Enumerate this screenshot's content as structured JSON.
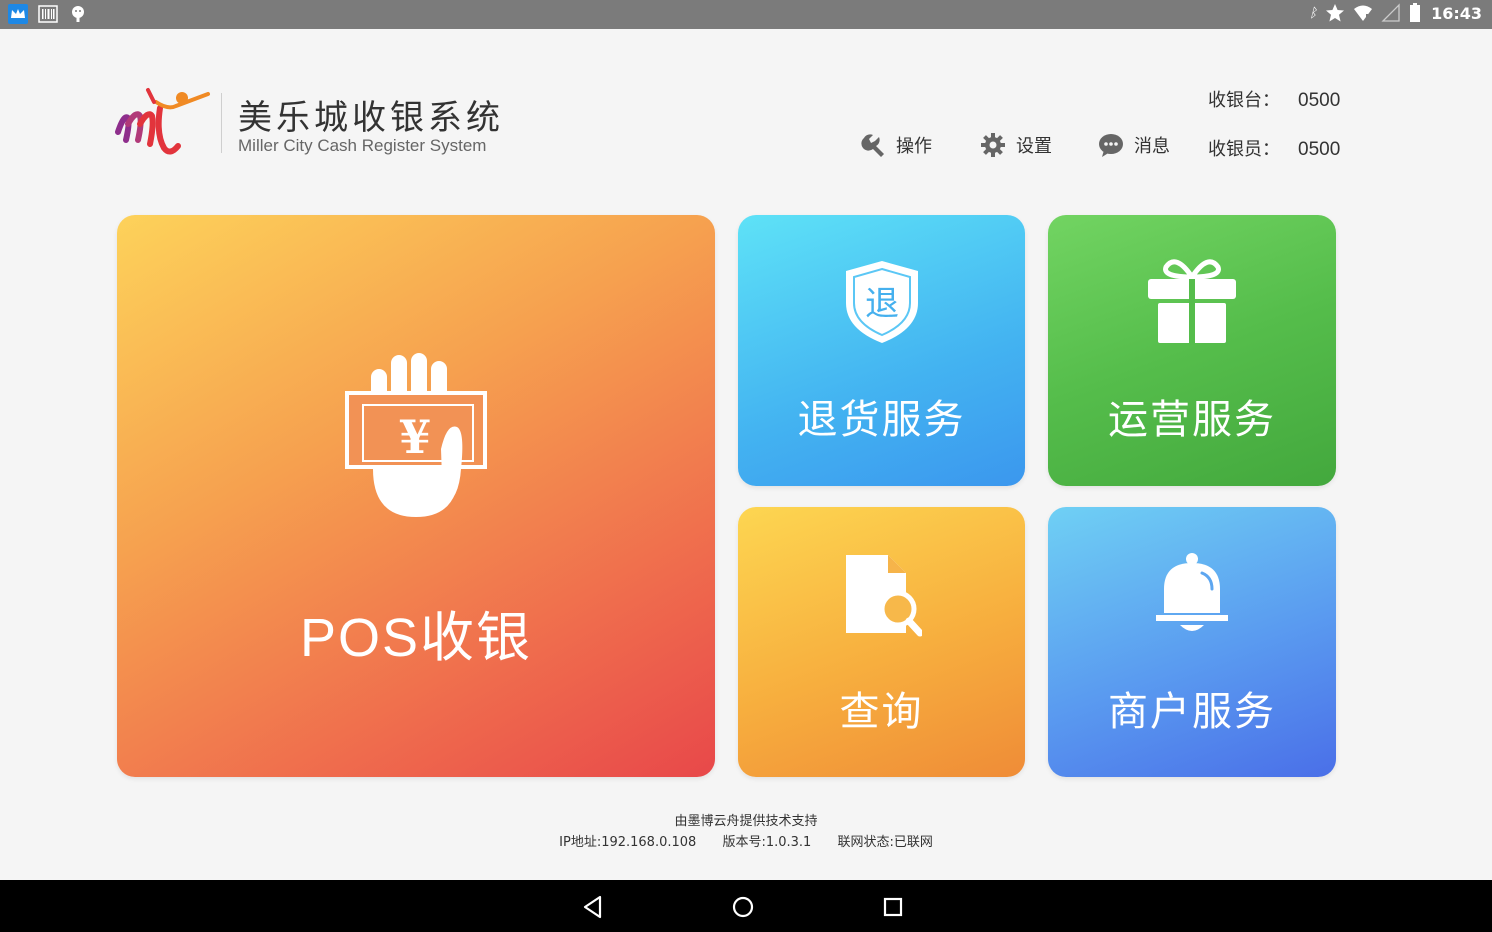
{
  "status_bar": {
    "left_icons": [
      "crown-app-icon",
      "barcode-icon",
      "android-debug-icon"
    ],
    "right_icons": [
      "bluetooth-icon",
      "star-icon",
      "wifi-icon",
      "signal-icon",
      "battery-icon"
    ],
    "bluetooth_glyph": "ᛒ",
    "time": "16:43"
  },
  "header": {
    "title": "美乐城收银系统",
    "subtitle": "Miller City Cash Register System",
    "register_label": "收银台：",
    "register_value": "0500",
    "cashier_label": "收银员：",
    "cashier_value": "0500",
    "toolbar": {
      "operate_label": "操作",
      "settings_label": "设置",
      "messages_label": "消息"
    }
  },
  "tiles": {
    "pos": {
      "label": "POS收银",
      "icon": "cash-hand-icon"
    },
    "refund": {
      "label": "退货服务",
      "icon": "refund-shield-icon",
      "icon_text": "退"
    },
    "ops": {
      "label": "运营服务",
      "icon": "gift-icon"
    },
    "query": {
      "label": "查询",
      "icon": "document-search-icon"
    },
    "merchant": {
      "label": "商户服务",
      "icon": "bell-icon"
    },
    "currency_glyph": "¥"
  },
  "footer": {
    "support": "由墨博云舟提供技术支持",
    "ip": "IP地址:192.168.0.108",
    "version": "版本号:1.0.3.1",
    "network": "联网状态:已联网"
  },
  "colors": {
    "pos_gradient": [
      "#fdd25a",
      "#e8484a"
    ],
    "refund_gradient": [
      "#5ee2f7",
      "#3b97ee"
    ],
    "ops_gradient": [
      "#72d462",
      "#43a83d"
    ],
    "query_gradient": [
      "#fdd651",
      "#ef8c37"
    ],
    "merchant_gradient": [
      "#6fd0f4",
      "#4a6fe8"
    ],
    "logo_orange": "#f08a24",
    "logo_purple": "#8e2e8c",
    "logo_red": "#e2343c"
  }
}
